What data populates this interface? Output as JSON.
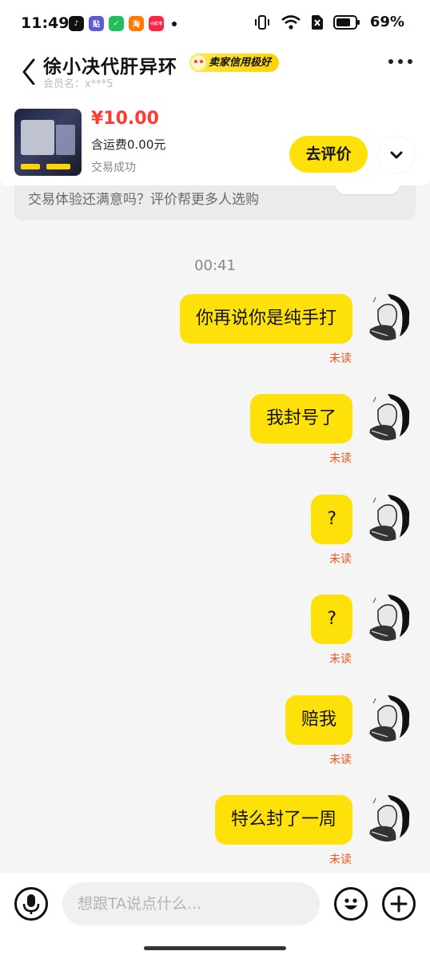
{
  "status_bar": {
    "time": "11:49",
    "app_icons": [
      {
        "name": "tiktok-app-icon",
        "glyph": "♪",
        "color": "#111111"
      },
      {
        "name": "tieba-app-icon",
        "glyph": "贴",
        "color": "#5b5bd6"
      },
      {
        "name": "wechat-app-icon",
        "glyph": "✓",
        "color": "#1fbf5b"
      },
      {
        "name": "taobao-app-icon",
        "glyph": "淘",
        "color": "#ff7a00"
      },
      {
        "name": "xiaohongshu-app-icon",
        "glyph": "小红书",
        "color": "#ff2442"
      }
    ],
    "battery": "69%"
  },
  "header": {
    "shop_name": "徐小决代肝异环",
    "credit_badge": "卖家信用极好",
    "member": "会员名：x***5"
  },
  "product": {
    "price": "¥10.00",
    "shipping": "含运费0.00元",
    "status": "交易成功",
    "review_button": "去评价"
  },
  "review_prompt": {
    "text": "交易体验还满意吗？评价帮更多人选购"
  },
  "chat": {
    "time": "00:41",
    "messages": [
      {
        "text": "你再说你是纯手打",
        "status": "未读"
      },
      {
        "text": "我封号了",
        "status": "未读"
      },
      {
        "text": "?",
        "status": "未读"
      },
      {
        "text": "?",
        "status": "未读"
      },
      {
        "text": "赔我",
        "status": "未读"
      },
      {
        "text": "特么封了一周",
        "status": "未读"
      }
    ]
  },
  "input": {
    "placeholder": "想跟TA说点什么..."
  },
  "colors": {
    "accent_yellow": "#ffe10a",
    "price_red": "#ff3b30",
    "unread_orange": "#e9541e"
  }
}
